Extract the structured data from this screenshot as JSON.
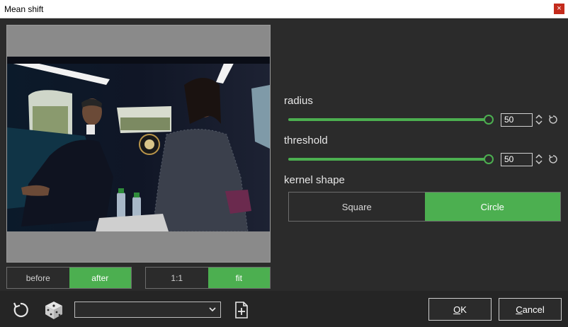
{
  "window": {
    "title": "Mean shift",
    "close_glyph": "×"
  },
  "preview": {
    "toggle_before": "before",
    "toggle_after": "after",
    "zoom_1_1": "1:1",
    "zoom_fit": "fit"
  },
  "params": {
    "radius": {
      "label": "radius",
      "value": "50"
    },
    "threshold": {
      "label": "threshold",
      "value": "50"
    },
    "kernel_shape": {
      "label": "kernel shape",
      "options": [
        "Square",
        "Circle"
      ],
      "selected": "Circle"
    }
  },
  "footer": {
    "preset_value": "",
    "ok_prefix": "",
    "ok_mnemonic": "O",
    "ok_rest": "K",
    "cancel_mnemonic": "C",
    "cancel_rest": "ancel"
  },
  "colors": {
    "accent": "#4caf50",
    "background": "#2b2b2b"
  },
  "icons": [
    "close-icon",
    "reset-icon",
    "dice-icon",
    "chevron-down-icon",
    "new-file-icon",
    "spin-arrows-icon",
    "reset-small-icon"
  ]
}
